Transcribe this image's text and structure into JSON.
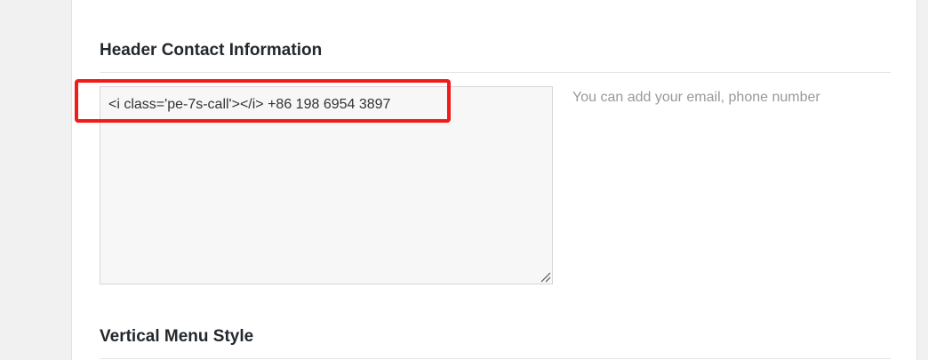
{
  "sections": [
    {
      "title": "Header Contact Information",
      "textarea_value": "<i class='pe-7s-call'></i> +86 198 6954 3897",
      "description": "You can add your email, phone number"
    },
    {
      "title": "Vertical Menu Style"
    }
  ],
  "colors": {
    "highlight": "#f01c1c",
    "background": "#f1f1f1",
    "panel": "#ffffff"
  }
}
